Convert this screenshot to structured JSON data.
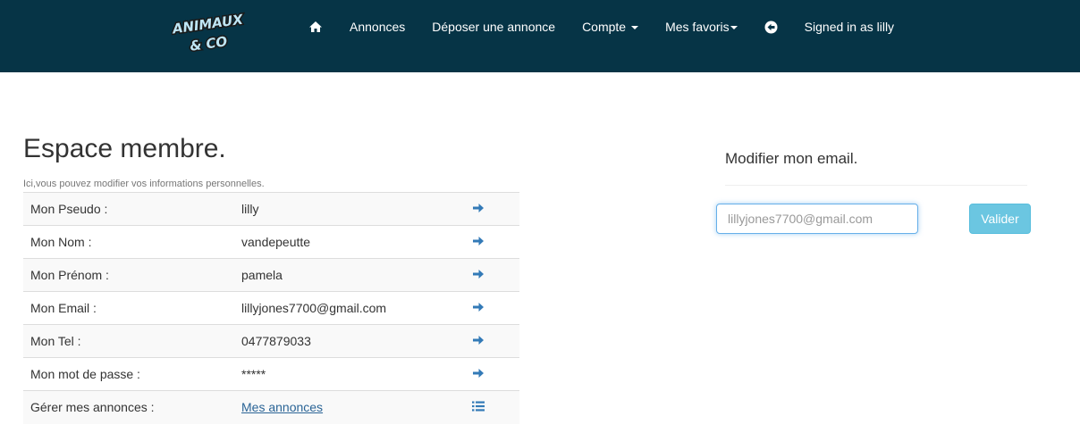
{
  "brand": {
    "logo_text_line1": "ANIMAUX",
    "logo_text_line2": "& CO"
  },
  "nav": {
    "home_icon": "home-icon",
    "items": [
      {
        "label": "Annonces"
      },
      {
        "label": "Déposer une annonce"
      },
      {
        "label": "Compte"
      },
      {
        "label": "Mes favoris"
      }
    ],
    "back_icon": "circle-arrow-left-icon",
    "signed_in": "Signed in as lilly"
  },
  "member": {
    "title": "Espace membre.",
    "subtitle": "Ici,vous pouvez modifier vos informations personnelles.",
    "rows": [
      {
        "label": "Mon Pseudo :",
        "value": "lilly",
        "action_icon": "arrow-right-icon"
      },
      {
        "label": "Mon Nom :",
        "value": "vandepeutte",
        "action_icon": "arrow-right-icon"
      },
      {
        "label": "Mon Prénom :",
        "value": "pamela",
        "action_icon": "arrow-right-icon"
      },
      {
        "label": "Mon Email :",
        "value": "lillyjones7700@gmail.com",
        "action_icon": "arrow-right-icon"
      },
      {
        "label": "Mon Tel :",
        "value": "0477879033",
        "action_icon": "arrow-right-icon"
      },
      {
        "label": "Mon mot de passe :",
        "value": "*****",
        "action_icon": "arrow-right-icon"
      },
      {
        "label": "Gérer mes annonces :",
        "value": "Mes annonces",
        "action_icon": "list-icon"
      }
    ]
  },
  "edit_email": {
    "title": "Modifier mon email.",
    "placeholder": "lillyjones7700@gmail.com",
    "value": "",
    "submit_label": "Valider"
  },
  "colors": {
    "navbar_bg": "#063446",
    "accent": "#337ab7",
    "button": "#5bc0de"
  }
}
